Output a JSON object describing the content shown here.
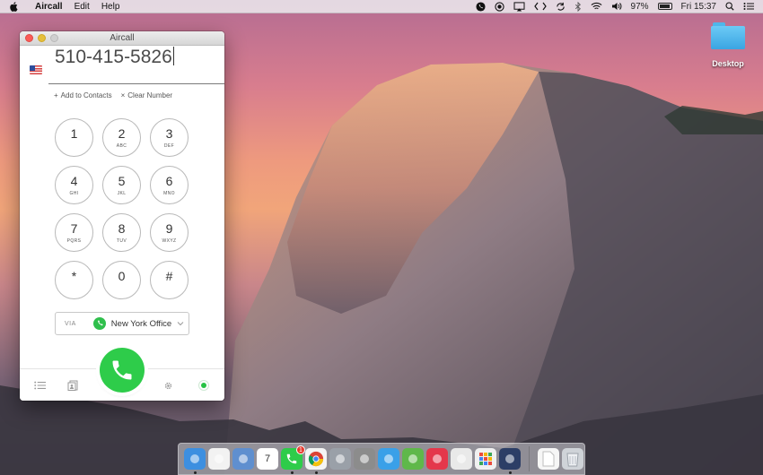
{
  "menubar": {
    "app_name": "Aircall",
    "menus": [
      "Edit",
      "Help"
    ],
    "battery_percent": "97%",
    "clock": "Fri 15:37"
  },
  "desktop": {
    "icons": [
      {
        "label": "Desktop",
        "icon": "folder-icon"
      }
    ]
  },
  "window": {
    "title": "Aircall",
    "number": "510-415-5826",
    "country_flag": "us-flag-icon",
    "actions": {
      "add_contacts": "Add to Contacts",
      "add_icon": "+",
      "clear_number": "Clear Number",
      "clear_icon": "×"
    },
    "keypad": [
      {
        "digit": "1",
        "letters": ""
      },
      {
        "digit": "2",
        "letters": "ABC"
      },
      {
        "digit": "3",
        "letters": "DEF"
      },
      {
        "digit": "4",
        "letters": "GHI"
      },
      {
        "digit": "5",
        "letters": "JKL"
      },
      {
        "digit": "6",
        "letters": "MNO"
      },
      {
        "digit": "7",
        "letters": "PQRS"
      },
      {
        "digit": "8",
        "letters": "TUV"
      },
      {
        "digit": "9",
        "letters": "WXYZ"
      },
      {
        "digit": "*",
        "letters": ""
      },
      {
        "digit": "0",
        "letters": ""
      },
      {
        "digit": "#",
        "letters": ""
      }
    ],
    "via": {
      "label": "VIA",
      "line_name": "New York Office"
    },
    "colors": {
      "call_green": "#2ecc4a",
      "status_online": "#27c244"
    }
  },
  "dock": {
    "apps": [
      {
        "name": "finder",
        "icon": "finder-icon",
        "color": "#3d8fe0",
        "running": true
      },
      {
        "name": "itunes",
        "icon": "music-icon",
        "color": "#f2f2f2",
        "running": false
      },
      {
        "name": "preview",
        "icon": "preview-icon",
        "color": "#5f8fcf",
        "running": false
      },
      {
        "name": "calendar",
        "icon": "calendar-icon",
        "color": "#ffffff",
        "label": "7",
        "running": false
      },
      {
        "name": "aircall",
        "icon": "aircall-icon",
        "color": "#2ecc4a",
        "badge": "1",
        "running": true
      },
      {
        "name": "chrome",
        "icon": "chrome-icon",
        "color": "#f4f4f4",
        "running": true
      },
      {
        "name": "launchpad",
        "icon": "rocket-icon",
        "color": "#9aa0a8",
        "running": false
      },
      {
        "name": "system-preferences",
        "icon": "gear-icon",
        "color": "#8c8c8c",
        "running": false
      },
      {
        "name": "twitter",
        "icon": "bird-icon",
        "color": "#3aa0e8",
        "running": false
      },
      {
        "name": "evernote",
        "icon": "elephant-icon",
        "color": "#5fb84a",
        "running": false
      },
      {
        "name": "pocket",
        "icon": "pocket-icon",
        "color": "#e4374b",
        "running": false
      },
      {
        "name": "scrivener",
        "icon": "scrivener-icon",
        "color": "#e9e9e9",
        "running": false
      },
      {
        "name": "grid-app",
        "icon": "grid-icon",
        "color": "#f0f0f0",
        "running": false
      },
      {
        "name": "quicktime",
        "icon": "quicktime-icon",
        "color": "#2c3e66",
        "running": true
      },
      {
        "name": "documents",
        "icon": "document-icon",
        "color": "#f6f6f6",
        "running": false
      },
      {
        "name": "trash",
        "icon": "trash-icon",
        "color": "#cfd3d8",
        "running": false
      }
    ]
  }
}
